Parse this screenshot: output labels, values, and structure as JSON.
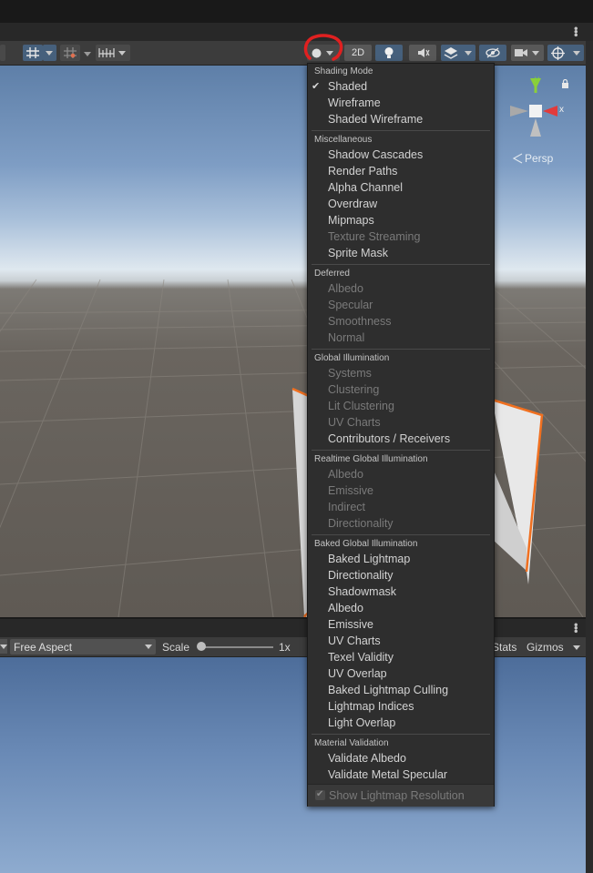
{
  "colors": {
    "selection_outline": "#f07020",
    "menu_bg": "#2e2e2e",
    "accent_blue": "#46607c",
    "annotation": "#e02020"
  },
  "scene_toolbar": {
    "toggle_2d_label": "2D",
    "icons": [
      "grid-snap-icon",
      "increment-snap-icon",
      "ruler-icon",
      "shading-mode-icon",
      "lighting-icon",
      "audio-mute-icon",
      "effects-icon",
      "scene-visibility-icon",
      "camera-icon",
      "gizmos-icon"
    ]
  },
  "gizmo": {
    "axis_x": "x",
    "axis_y": "y",
    "projection_label": "Persp"
  },
  "game_toolbar": {
    "aspect_select": "Free Aspect",
    "scale_label": "Scale",
    "scale_value": "1x",
    "stats_label": "Stats",
    "gizmos_label": "Gizmos"
  },
  "shading_menu": {
    "sections": [
      {
        "header": "Shading Mode",
        "items": [
          {
            "label": "Shaded",
            "checked": true,
            "enabled": true
          },
          {
            "label": "Wireframe",
            "enabled": true
          },
          {
            "label": "Shaded Wireframe",
            "enabled": true
          }
        ]
      },
      {
        "header": "Miscellaneous",
        "items": [
          {
            "label": "Shadow Cascades",
            "enabled": true
          },
          {
            "label": "Render Paths",
            "enabled": true
          },
          {
            "label": "Alpha Channel",
            "enabled": true
          },
          {
            "label": "Overdraw",
            "enabled": true
          },
          {
            "label": "Mipmaps",
            "enabled": true
          },
          {
            "label": "Texture Streaming",
            "enabled": false
          },
          {
            "label": "Sprite Mask",
            "enabled": true
          }
        ]
      },
      {
        "header": "Deferred",
        "items": [
          {
            "label": "Albedo",
            "enabled": false
          },
          {
            "label": "Specular",
            "enabled": false
          },
          {
            "label": "Smoothness",
            "enabled": false
          },
          {
            "label": "Normal",
            "enabled": false
          }
        ]
      },
      {
        "header": "Global Illumination",
        "items": [
          {
            "label": "Systems",
            "enabled": false
          },
          {
            "label": "Clustering",
            "enabled": false
          },
          {
            "label": "Lit Clustering",
            "enabled": false
          },
          {
            "label": "UV Charts",
            "enabled": false
          },
          {
            "label": "Contributors / Receivers",
            "enabled": true
          }
        ]
      },
      {
        "header": "Realtime Global Illumination",
        "items": [
          {
            "label": "Albedo",
            "enabled": false
          },
          {
            "label": "Emissive",
            "enabled": false
          },
          {
            "label": "Indirect",
            "enabled": false
          },
          {
            "label": "Directionality",
            "enabled": false
          }
        ]
      },
      {
        "header": "Baked Global Illumination",
        "items": [
          {
            "label": "Baked Lightmap",
            "enabled": true
          },
          {
            "label": "Directionality",
            "enabled": true
          },
          {
            "label": "Shadowmask",
            "enabled": true
          },
          {
            "label": "Albedo",
            "enabled": true
          },
          {
            "label": "Emissive",
            "enabled": true
          },
          {
            "label": "UV Charts",
            "enabled": true
          },
          {
            "label": "Texel Validity",
            "enabled": true
          },
          {
            "label": "UV Overlap",
            "enabled": true
          },
          {
            "label": "Baked Lightmap Culling",
            "enabled": true
          },
          {
            "label": "Lightmap Indices",
            "enabled": true
          },
          {
            "label": "Light Overlap",
            "enabled": true
          }
        ]
      },
      {
        "header": "Material Validation",
        "items": [
          {
            "label": "Validate Albedo",
            "enabled": true
          },
          {
            "label": "Validate Metal Specular",
            "enabled": true
          }
        ]
      }
    ],
    "footer": {
      "label": "Show Lightmap Resolution",
      "checked": true,
      "enabled": false
    }
  }
}
